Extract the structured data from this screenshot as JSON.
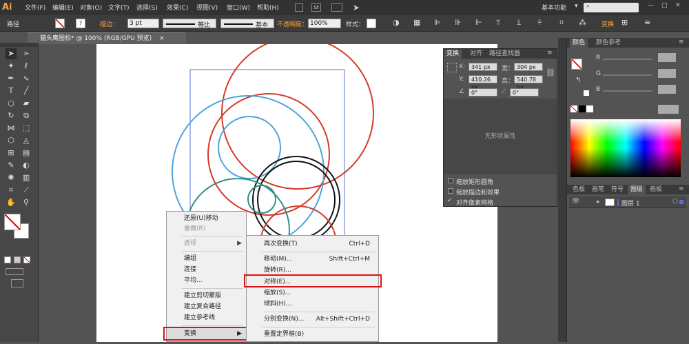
{
  "menubar": {
    "logo": "Ai",
    "items": [
      "文件(F)",
      "编辑(E)",
      "对象(O)",
      "文字(T)",
      "选择(S)",
      "效果(C)",
      "视图(V)",
      "窗口(W)",
      "帮助(H)"
    ],
    "workspace": "基本功能",
    "workspace_arrow": "▾",
    "search_icon": "search-icon"
  },
  "control": {
    "path_label": "路径",
    "stroke_label": "描边：",
    "stroke_value": "3 pt",
    "profile": "等比",
    "brush": "基本",
    "opacity_label": "不透明度：",
    "opacity_value": "100%",
    "style_label": "样式：",
    "transform_label": "变换"
  },
  "doc": {
    "tab_title": "猫头鹰图标* @ 100% (RGB/GPU 预览)",
    "close": "×"
  },
  "transform_panel": {
    "tabs": [
      "变换",
      "对齐",
      "路径查找器"
    ],
    "x_label": "X:",
    "x": "341 px",
    "w_label": "宽：",
    "w": "304 px",
    "y_label": "Y:",
    "y": "410.26 px",
    "h_label": "高：",
    "h": "540.78 px",
    "angle": "0°",
    "shear": "0°",
    "no_shape": "无形状属性",
    "opt1": "缩放矩形圆角",
    "opt2": "缩放描边和效果",
    "opt3": "对齐像素网格",
    "check": "✓"
  },
  "color_panel": {
    "tabs": [
      "颜色",
      "颜色参考"
    ],
    "r": "R",
    "g": "G",
    "b": "B"
  },
  "layers_panel": {
    "tabs": [
      "色板",
      "画笔",
      "符号",
      "图层",
      "画板"
    ],
    "layer_name": "图层 1"
  },
  "ctx_menu": {
    "items": [
      {
        "label": "还原(U)移动",
        "disabled": false
      },
      {
        "label": "重做(R)",
        "disabled": true
      },
      {
        "label": "透视",
        "disabled": true
      },
      {
        "label": "编组",
        "disabled": false
      },
      {
        "label": "连接",
        "disabled": false
      },
      {
        "label": "平均...",
        "disabled": false
      },
      {
        "label": "建立剪切蒙版",
        "disabled": false
      },
      {
        "label": "建立复合路径",
        "disabled": false
      },
      {
        "label": "建立参考线",
        "disabled": false
      },
      {
        "label": "变换",
        "disabled": false
      }
    ],
    "arrow": "▶"
  },
  "sub_menu": {
    "items": [
      {
        "label": "再次变换(T)",
        "shortcut": "Ctrl+D"
      },
      {
        "label": "移动(M)...",
        "shortcut": "Shift+Ctrl+M"
      },
      {
        "label": "旋转(R)...",
        "shortcut": ""
      },
      {
        "label": "对称(E)...",
        "shortcut": ""
      },
      {
        "label": "缩放(S)...",
        "shortcut": ""
      },
      {
        "label": "倾斜(H)...",
        "shortcut": ""
      },
      {
        "label": "分别变换(N)...",
        "shortcut": "Alt+Shift+Ctrl+D"
      },
      {
        "label": "重置定界框(B)",
        "shortcut": ""
      }
    ]
  },
  "colors": {
    "accent_red": "#d11",
    "selection": "#5a6fd6",
    "blue_circle": "#4ea3d8",
    "red_circle": "#d33a2a",
    "teal_circle": "#2f8f86"
  }
}
